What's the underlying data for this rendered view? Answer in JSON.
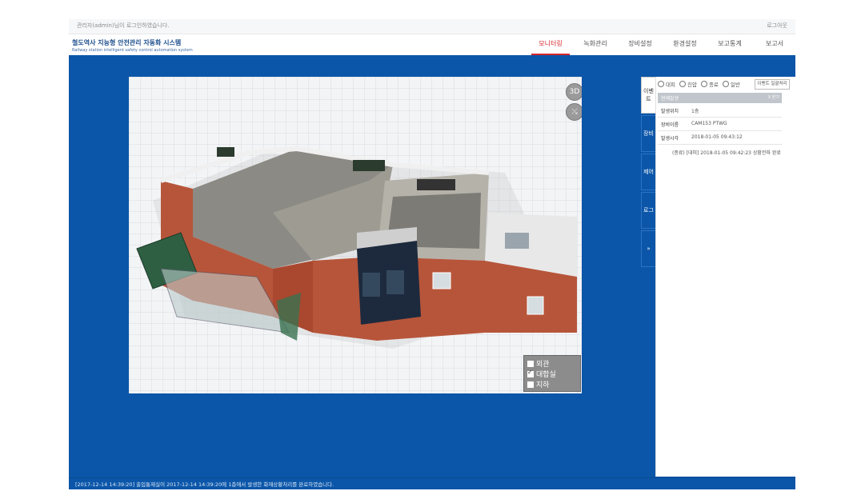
{
  "topbar": {
    "login_text": "관리자(admin)님이 로그인하였습니다.",
    "logout": "로그아웃"
  },
  "brand": {
    "title": "철도역사 지능형 안전관리 자동화 시스템",
    "subtitle": "Railway station intelligent safety control automation system"
  },
  "nav": [
    {
      "label": "모니터링",
      "active": true
    },
    {
      "label": "녹화관리",
      "active": false
    },
    {
      "label": "장비설정",
      "active": false
    },
    {
      "label": "환경설정",
      "active": false
    },
    {
      "label": "보고통계",
      "active": false
    },
    {
      "label": "보고서",
      "active": false
    }
  ],
  "viewer": {
    "controls": [
      {
        "label": "3D",
        "icon": "3d-view-icon"
      },
      {
        "label": "⤯",
        "icon": "expand-icon"
      }
    ],
    "layers": [
      {
        "label": "외관",
        "checked": false
      },
      {
        "label": "대합실",
        "checked": true
      },
      {
        "label": "지하",
        "checked": false
      }
    ]
  },
  "side_tabs": [
    {
      "label": "이벤트",
      "active": true
    },
    {
      "label": "장비",
      "active": false
    },
    {
      "label": "제어",
      "active": false
    },
    {
      "label": "로그",
      "active": false
    },
    {
      "label": "»",
      "active": false
    }
  ],
  "event_panel": {
    "filters": [
      "대피",
      "진압",
      "종료",
      "일반"
    ],
    "ack_button": "이벤트 일괄처리",
    "header": "현재발생",
    "close_label": "X 닫기",
    "rows": [
      {
        "key": "발생위치",
        "value": "1층"
      },
      {
        "key": "장비이름",
        "value": "CAM153 PTWG"
      },
      {
        "key": "발생시각",
        "value": "2018-01-05 09:43:12"
      }
    ],
    "log": "(종료) [대피] 2018-01-05 09:42:23 상황전파 완료"
  },
  "status_message": "[2017-12-14 14:39:20] 출입통제실이 2017-12-14 14:39:20에 1층에서 발생한 화재상황처리를 완료하였습니다.",
  "colors": {
    "primary_blue": "#0b56a9",
    "active_red": "#d7262b",
    "panel_header": "#c0c6cc"
  }
}
